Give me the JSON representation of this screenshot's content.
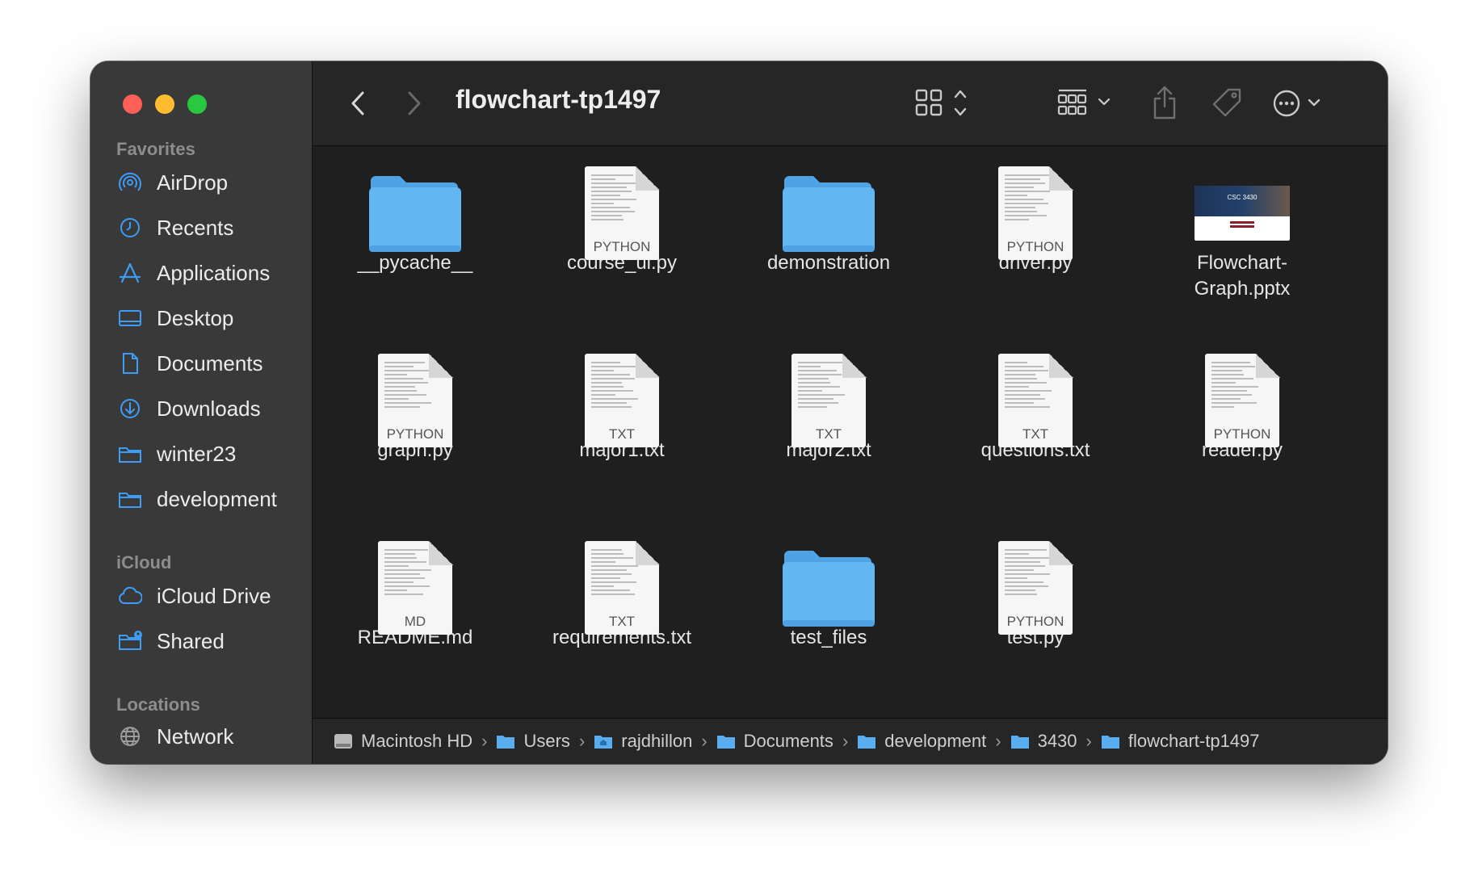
{
  "window": {
    "title": "flowchart-tp1497"
  },
  "sidebar": {
    "sections": [
      {
        "label": "Favorites"
      },
      {
        "label": "iCloud"
      },
      {
        "label": "Locations"
      }
    ],
    "favorites": [
      {
        "label": "AirDrop",
        "icon": "airdrop-icon"
      },
      {
        "label": "Recents",
        "icon": "clock-icon"
      },
      {
        "label": "Applications",
        "icon": "applications-icon"
      },
      {
        "label": "Desktop",
        "icon": "desktop-icon"
      },
      {
        "label": "Documents",
        "icon": "document-icon"
      },
      {
        "label": "Downloads",
        "icon": "download-icon"
      },
      {
        "label": "winter23",
        "icon": "folder-icon"
      },
      {
        "label": "development",
        "icon": "folder-icon"
      }
    ],
    "icloud": [
      {
        "label": "iCloud Drive",
        "icon": "cloud-icon"
      },
      {
        "label": "Shared",
        "icon": "shared-folder-icon"
      }
    ],
    "locations": [
      {
        "label": "Network",
        "icon": "globe-icon"
      }
    ]
  },
  "files": [
    {
      "name": "__pycache__",
      "kind": "folder"
    },
    {
      "name": "course_ui.py",
      "kind": "doc",
      "type": "PYTHON"
    },
    {
      "name": "demonstration",
      "kind": "folder"
    },
    {
      "name": "driver.py",
      "kind": "doc",
      "type": "PYTHON"
    },
    {
      "name": "Flowchart-\nGraph.pptx",
      "kind": "pptx",
      "thumb": "CSC 3430"
    },
    {
      "name": "graph.py",
      "kind": "doc",
      "type": "PYTHON"
    },
    {
      "name": "major1.txt",
      "kind": "doc",
      "type": "TXT"
    },
    {
      "name": "major2.txt",
      "kind": "doc",
      "type": "TXT"
    },
    {
      "name": "questions.txt",
      "kind": "doc",
      "type": "TXT"
    },
    {
      "name": "reader.py",
      "kind": "doc",
      "type": "PYTHON"
    },
    {
      "name": "README.md",
      "kind": "doc",
      "type": "MD"
    },
    {
      "name": "requirements.txt",
      "kind": "doc",
      "type": "TXT"
    },
    {
      "name": "test_files",
      "kind": "folder"
    },
    {
      "name": "test.py",
      "kind": "doc",
      "type": "PYTHON"
    }
  ],
  "pathbar": [
    {
      "label": "Macintosh HD",
      "icon": "hard-drive-icon"
    },
    {
      "label": "Users",
      "icon": "folder-icon"
    },
    {
      "label": "rajdhillon",
      "icon": "home-folder-icon"
    },
    {
      "label": "Documents",
      "icon": "folder-icon"
    },
    {
      "label": "development",
      "icon": "folder-icon"
    },
    {
      "label": "3430",
      "icon": "folder-icon"
    },
    {
      "label": "flowchart-tp1497",
      "icon": "folder-icon"
    }
  ],
  "colors": {
    "accent": "#2c8cf4",
    "folder": "#5bb3f0",
    "sidebar_bg": "#393939",
    "window_bg": "#1f1f1f"
  }
}
